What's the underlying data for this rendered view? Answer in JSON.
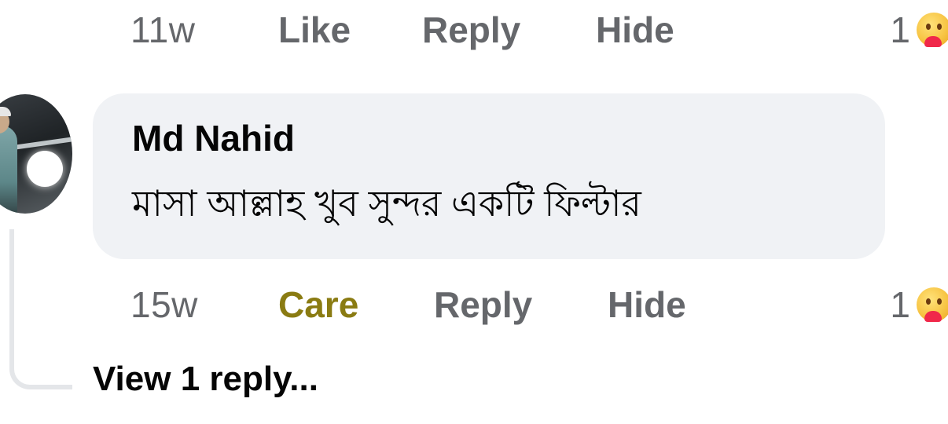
{
  "top_actions": {
    "time": "11w",
    "like_label": "Like",
    "reply_label": "Reply",
    "hide_label": "Hide",
    "reaction_count": "1"
  },
  "comment": {
    "author": "Md Nahid",
    "text": "মাসা আল্লাহ খুব সুন্দর একটি ফিল্টার",
    "time": "15w",
    "reaction_label": "Care",
    "reaction_color": "#8a7b12",
    "reply_label": "Reply",
    "hide_label": "Hide",
    "reaction_count": "1",
    "reaction_icon": "care-emoji-icon"
  },
  "view_replies_label": "View 1 reply..."
}
